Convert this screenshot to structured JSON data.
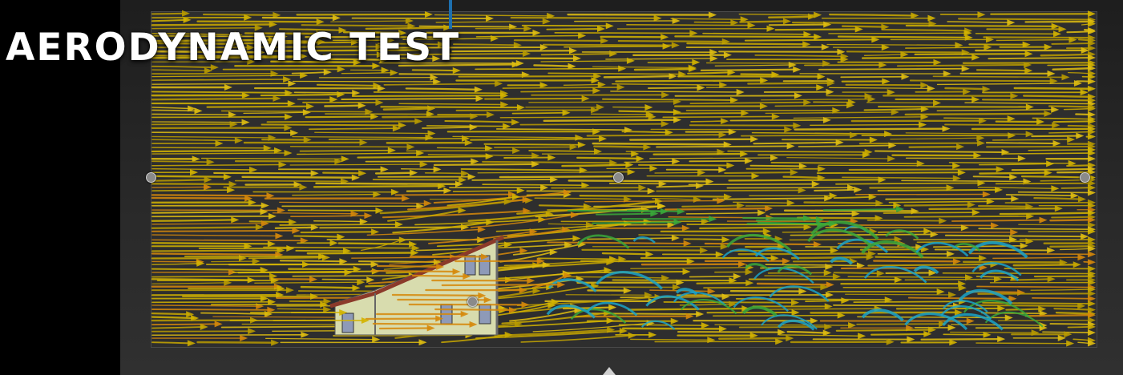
{
  "title": "AERODYNAMIC TEST",
  "colors": {
    "background": "#000000",
    "viewport": "#2a2a2a",
    "flow_fast": "#d4b400",
    "flow_mid": "#d6880a",
    "flow_vortex": "#1aa3c8",
    "flow_transition": "#3aa83a",
    "building_wall": "#d8dcae",
    "building_roof": "#8b3a2a",
    "window": "#8e9ab8",
    "title_text": "#ffffff"
  },
  "icons": {
    "domain_handles": "circle-handle-icon",
    "bottom_marker": "caret-up-icon",
    "axis_indicator": "axis-z-icon"
  }
}
